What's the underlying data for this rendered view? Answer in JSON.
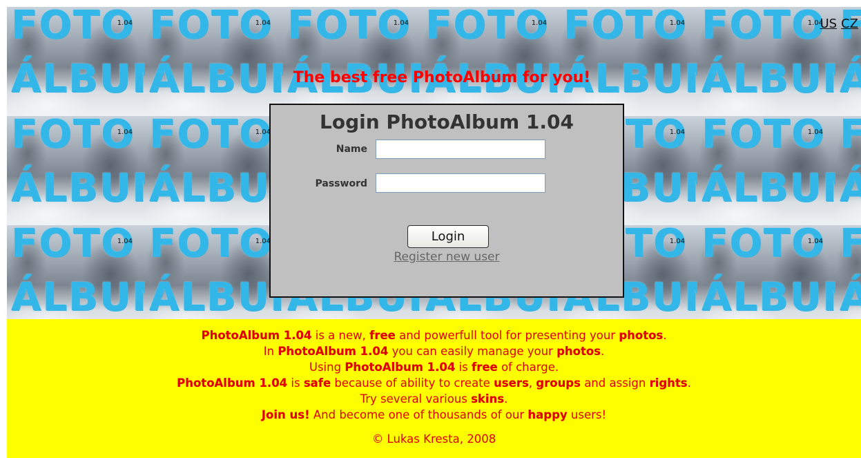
{
  "lang_links": {
    "us": "US",
    "cz": "CZ"
  },
  "tile": {
    "foto": "FOTO",
    "album": "ÁLBUM",
    "version": "1.04"
  },
  "tagline": "The best free PhotoAlbum for you!",
  "login": {
    "title": "Login PhotoAlbum 1.04",
    "name_label": "Name",
    "name_value": "",
    "password_label": "Password",
    "password_value": "",
    "button": "Login",
    "register_link": "Register new user"
  },
  "info": {
    "lines": [
      [
        {
          "t": "PhotoAlbum 1.04",
          "b": true
        },
        {
          "t": " is a new, "
        },
        {
          "t": "free",
          "b": true
        },
        {
          "t": " and powerfull tool for presenting your "
        },
        {
          "t": "photos",
          "b": true
        },
        {
          "t": "."
        }
      ],
      [
        {
          "t": "In "
        },
        {
          "t": "PhotoAlbum 1.04",
          "b": true
        },
        {
          "t": " you can easily manage your "
        },
        {
          "t": "photos",
          "b": true
        },
        {
          "t": "."
        }
      ],
      [
        {
          "t": "Using "
        },
        {
          "t": "PhotoAlbum 1.04",
          "b": true
        },
        {
          "t": " is "
        },
        {
          "t": "free",
          "b": true
        },
        {
          "t": " of charge."
        }
      ],
      [
        {
          "t": "PhotoAlbum 1.04",
          "b": true
        },
        {
          "t": " is "
        },
        {
          "t": "safe",
          "b": true
        },
        {
          "t": " because of ability to create "
        },
        {
          "t": "users",
          "b": true
        },
        {
          "t": ", "
        },
        {
          "t": "groups",
          "b": true
        },
        {
          "t": " and assign "
        },
        {
          "t": "rights",
          "b": true
        },
        {
          "t": "."
        }
      ],
      [
        {
          "t": "Try several various "
        },
        {
          "t": "skins",
          "b": true
        },
        {
          "t": "."
        }
      ],
      [
        {
          "t": "Join us!",
          "b": true
        },
        {
          "t": " And become one of thousands of our "
        },
        {
          "t": "happy",
          "b": true
        },
        {
          "t": " users!"
        }
      ]
    ],
    "copyright": "© Lukas Kresta, 2008"
  },
  "colors": {
    "tagline": "#ff0000",
    "info_background": "#ffff00",
    "info_text": "#e00000",
    "login_box": "#c0c0c0",
    "logo_blue": "#33b7e8"
  }
}
